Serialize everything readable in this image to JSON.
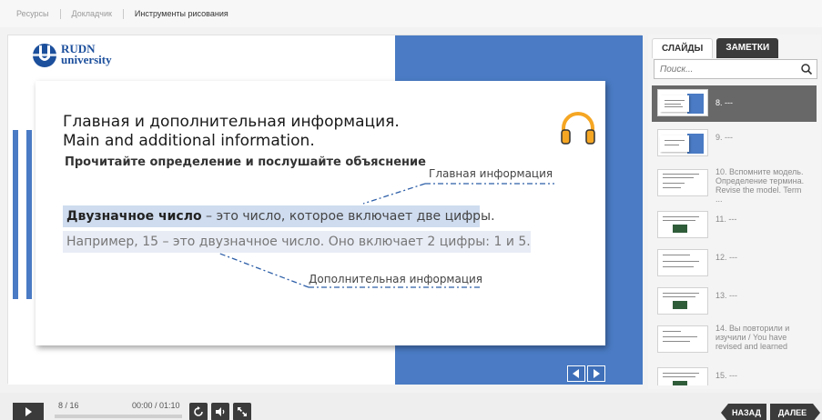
{
  "top_tabs": [
    {
      "label": "Ресурсы"
    },
    {
      "label": "Докладчик"
    },
    {
      "label": "Инструменты рисования"
    }
  ],
  "slide": {
    "logo_line1": "RUDN",
    "logo_line2": "university",
    "title_line1": "Главная и дополнительная информация.",
    "title_line2": "Main and additional information.",
    "instruction": "Прочитайте определение и послушайте объяснение",
    "label_main": "Главная информация",
    "definition_term": "Двузначное число",
    "definition_rest": " – это число, которое включает две цифры.",
    "example": "Например, 15 – это двузначное число. Оно включает 2 цифры: 1 и 5.",
    "label_extra": "Дополнительная информация"
  },
  "sidebar": {
    "tab_slides": "СЛАЙДЫ",
    "tab_notes": "ЗАМЕТКИ",
    "search_placeholder": "Поиск...",
    "items": [
      {
        "label": "8. ---",
        "selected": true
      },
      {
        "label": "9. ---"
      },
      {
        "label": "10. Вспомните модель. Определение термина. Revise the model. Term ..."
      },
      {
        "label": "11. ---"
      },
      {
        "label": "12. ---"
      },
      {
        "label": "13. ---"
      },
      {
        "label": "14. Вы повторили и изучили / You have revised and learned"
      },
      {
        "label": "15. ---"
      }
    ]
  },
  "player": {
    "counter": "8 / 16",
    "time": "00:00 / 01:10",
    "progress": 0.0,
    "prev_label": "НАЗАД",
    "next_label": "ДАЛЕЕ"
  },
  "colors": {
    "accent_blue": "#4a7bc4",
    "dark": "#3b3b3b",
    "headphones_orange": "#f5a623"
  },
  "icons": [
    "play-icon",
    "replay-icon",
    "volume-icon",
    "fullscreen-icon",
    "search-icon",
    "headphones-icon",
    "arrow-left-icon",
    "arrow-right-icon"
  ]
}
